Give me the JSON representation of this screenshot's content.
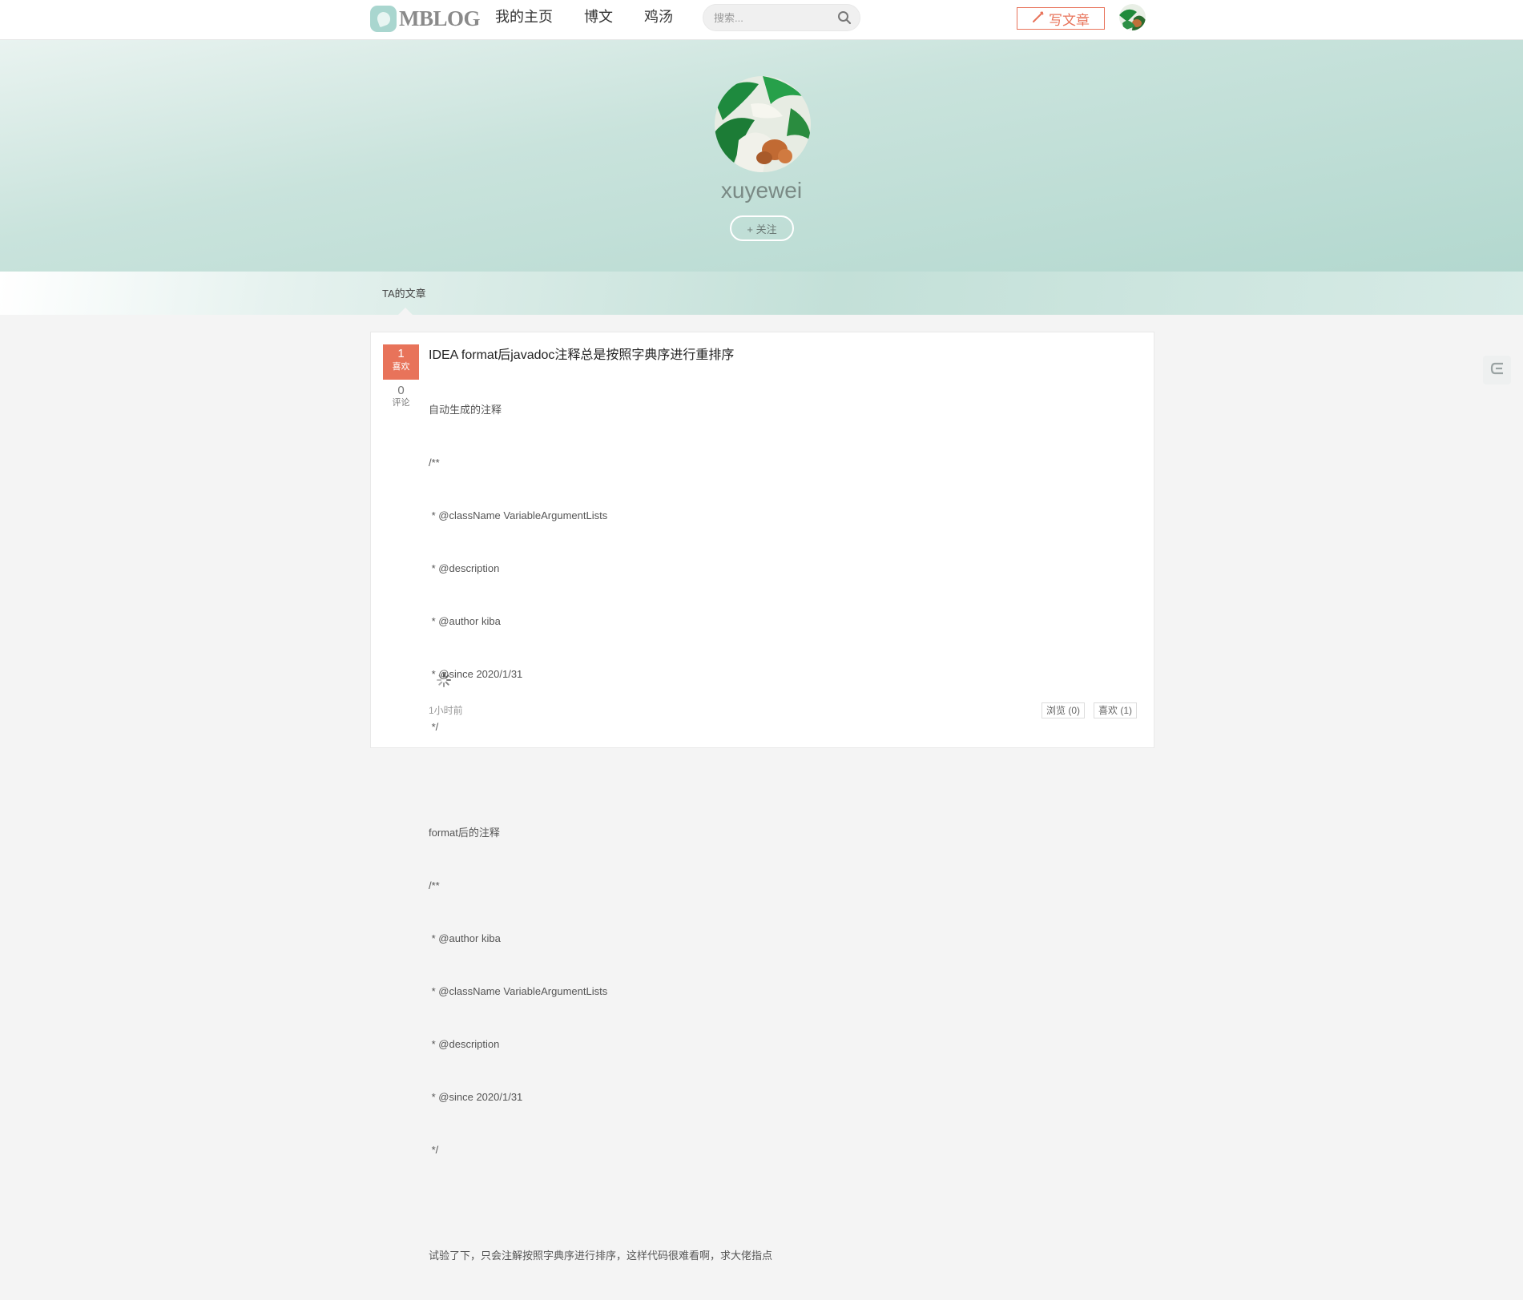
{
  "brand": {
    "name": "MBLOG"
  },
  "nav": {
    "items": [
      "我的主页",
      "博文",
      "鸡汤"
    ]
  },
  "search": {
    "placeholder": "搜索..."
  },
  "header": {
    "write_label": "写文章"
  },
  "profile": {
    "username": "xuyewei",
    "follow_label": "+ 关注"
  },
  "tabs": {
    "active": "TA的文章"
  },
  "article": {
    "title": "IDEA format后javadoc注释总是按照字典序进行重排序",
    "likes": "1",
    "likes_label": "喜欢",
    "comments": "0",
    "comments_label": "评论",
    "body_lines": [
      "自动生成的注释",
      "/**",
      " * @className VariableArgumentLists",
      " * @description",
      " * @author kiba",
      " * @since 2020/1/31",
      " */",
      "",
      "format后的注释",
      "/**",
      " * @author kiba",
      " * @className VariableArgumentLists",
      " * @description",
      " * @since 2020/1/31",
      " */",
      "",
      "试验了下，只会注解按照字典序进行排序，这样代码很难看啊，求大佬指点"
    ],
    "time": "1小时前",
    "views_label": "浏览 (0)",
    "likes_stat_label": "喜欢 (1)"
  },
  "colors": {
    "accent": "#e8735a",
    "hero_teal": "#b3d8cf"
  },
  "icons": [
    "search-icon",
    "pen-icon",
    "spinner-icon",
    "side-tool-icon"
  ]
}
